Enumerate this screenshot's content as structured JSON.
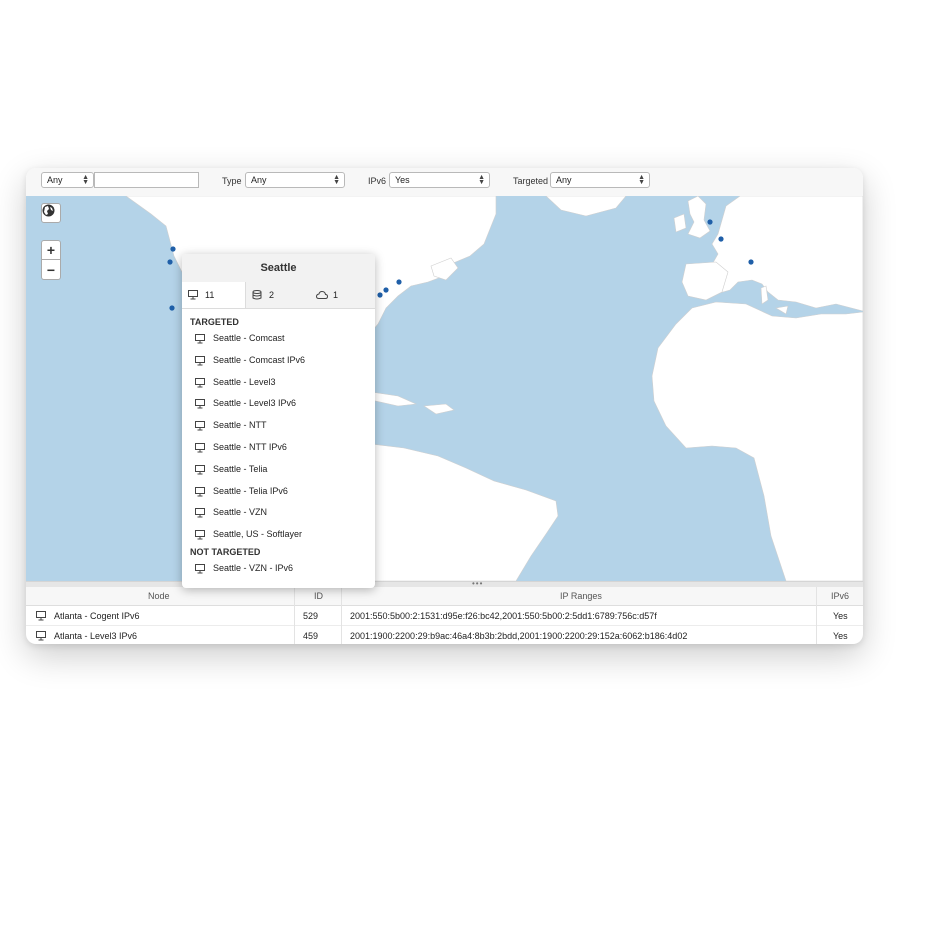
{
  "filters": {
    "scope_select": "Any",
    "search_value": "",
    "type_label": "Type",
    "type_select": "Any",
    "ipv6_label": "IPv6",
    "ipv6_select": "Yes",
    "targeted_label": "Targeted",
    "targeted_select": "Any"
  },
  "map": {
    "zoom_in": "+",
    "zoom_out": "−",
    "water_color": "#b4d3e8",
    "land_color": "#ffffff",
    "marker_color": "#1f5fa8"
  },
  "popup": {
    "title": "Seattle",
    "tabs": [
      {
        "icon": "monitor-icon",
        "count": "11"
      },
      {
        "icon": "database-icon",
        "count": "2"
      },
      {
        "icon": "cloud-icon",
        "count": "1"
      }
    ],
    "targeted_heading": "TARGETED",
    "targeted": [
      "Seattle - Comcast",
      "Seattle - Comcast IPv6",
      "Seattle - Level3",
      "Seattle - Level3 IPv6",
      "Seattle - NTT",
      "Seattle - NTT IPv6",
      "Seattle - Telia",
      "Seattle - Telia IPv6",
      "Seattle - VZN",
      "Seattle, US - Softlayer"
    ],
    "not_targeted_heading": "NOT TARGETED",
    "not_targeted": [
      "Seattle - VZN - IPv6"
    ]
  },
  "table": {
    "columns": [
      "Node",
      "ID",
      "IP Ranges",
      "IPv6"
    ],
    "rows": [
      {
        "node": "Atlanta - Cogent IPv6",
        "id": "529",
        "ip_ranges": "2001:550:5b00:2:1531:d95e:f26:bc42,2001:550:5b00:2:5dd1:6789:756c:d57f",
        "ipv6": "Yes"
      },
      {
        "node": "Atlanta - Level3 IPv6",
        "id": "459",
        "ip_ranges": "2001:1900:2200:29:b9ac:46a4:8b3b:2bdd,2001:1900:2200:29:152a:6062:b186:4d02",
        "ipv6": "Yes"
      }
    ]
  }
}
